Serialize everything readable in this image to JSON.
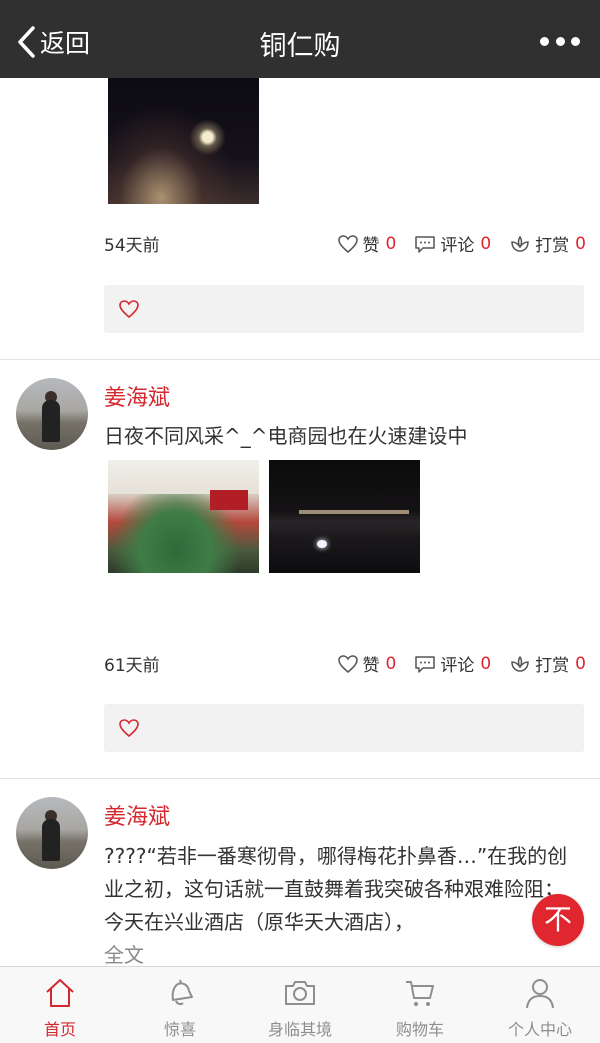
{
  "nav": {
    "back_label": "返回",
    "title": "铜仁购"
  },
  "posts": [
    {
      "time": "54天前",
      "actions": {
        "like_label": "赞",
        "like_count": "0",
        "comment_label": "评论",
        "comment_count": "0",
        "reward_label": "打赏",
        "reward_count": "0"
      }
    },
    {
      "author": "姜海斌",
      "text": "日夜不同风采^_^电商园也在火速建设中",
      "time": "61天前",
      "actions": {
        "like_label": "赞",
        "like_count": "0",
        "comment_label": "评论",
        "comment_count": "0",
        "reward_label": "打赏",
        "reward_count": "0"
      }
    },
    {
      "author": "姜海斌",
      "text": "????“若非一番寒彻骨，哪得梅花扑鼻香…”在我的创业之初，这句话就一直鼓舞着我突破各种艰难险阻；今天在兴业酒店（原华天大酒店），",
      "more_label": "全文"
    }
  ],
  "fab": {
    "label": "不"
  },
  "tabs": [
    {
      "label": "首页",
      "icon": "home-icon",
      "active": true
    },
    {
      "label": "惊喜",
      "icon": "bell-icon",
      "active": false
    },
    {
      "label": "身临其境",
      "icon": "camera-icon",
      "active": false
    },
    {
      "label": "购物车",
      "icon": "cart-icon",
      "active": false
    },
    {
      "label": "个人中心",
      "icon": "user-icon",
      "active": false
    }
  ],
  "colors": {
    "accent": "#d4282f",
    "navbar": "#303030",
    "count": "#e0242e"
  }
}
